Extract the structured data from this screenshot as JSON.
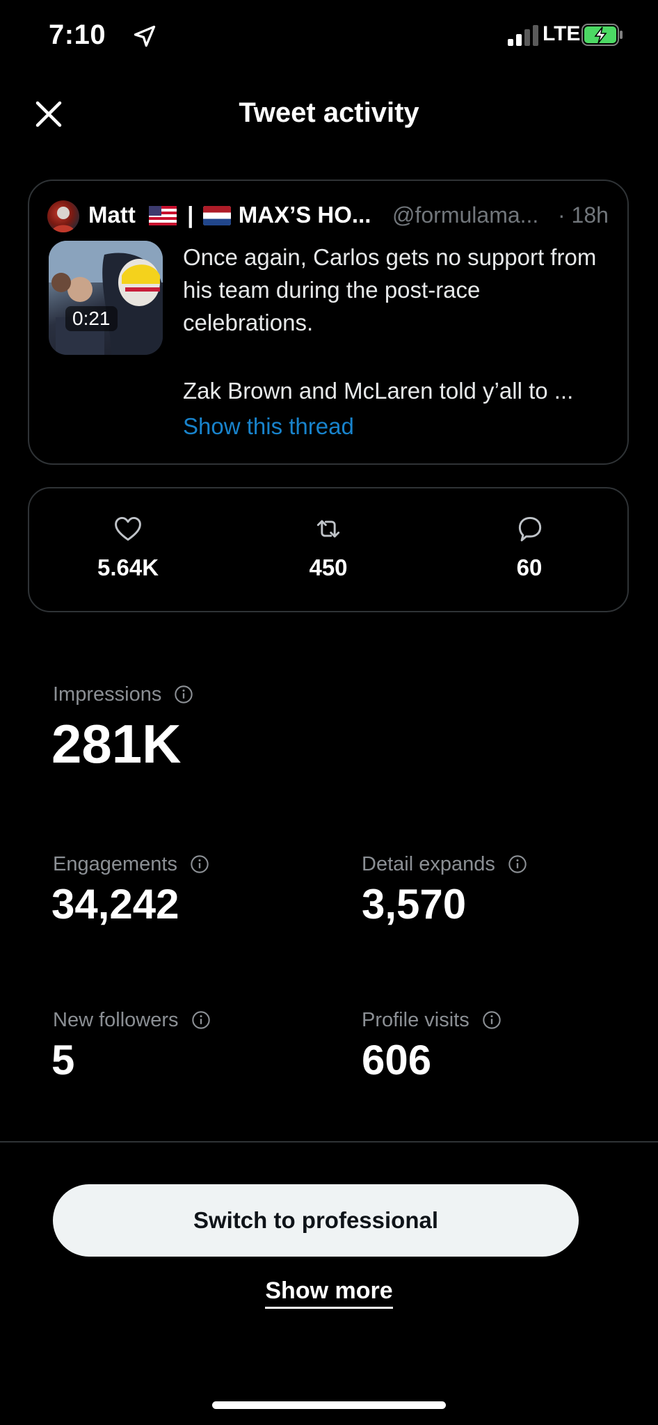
{
  "status_bar": {
    "time": "7:10",
    "network": "LTE"
  },
  "header": {
    "title": "Tweet activity"
  },
  "tweet": {
    "author_name": "Matt",
    "author_separator": "|",
    "author_name_suffix": "MAX’S HO...",
    "handle": "@formulama...",
    "time": "· 18h",
    "video_duration": "0:21",
    "text_line1": "Once again, Carlos gets no support from his team during the post-race celebrations.",
    "text_line2": "Zak Brown and McLaren told y’all to ...",
    "show_thread": "Show this thread"
  },
  "engagement": {
    "likes": "5.64K",
    "retweets": "450",
    "replies": "60"
  },
  "metrics": {
    "impressions_label": "Impressions",
    "impressions_value": "281K",
    "engagements_label": "Engagements",
    "engagements_value": "34,242",
    "detail_expands_label": "Detail expands",
    "detail_expands_value": "3,570",
    "new_followers_label": "New followers",
    "new_followers_value": "5",
    "profile_visits_label": "Profile visits",
    "profile_visits_value": "606"
  },
  "actions": {
    "switch_professional": "Switch to professional",
    "show_more": "Show more"
  },
  "colors": {
    "link": "#1d9bf0",
    "battery": "#4cd964",
    "border": "#2f3336"
  }
}
